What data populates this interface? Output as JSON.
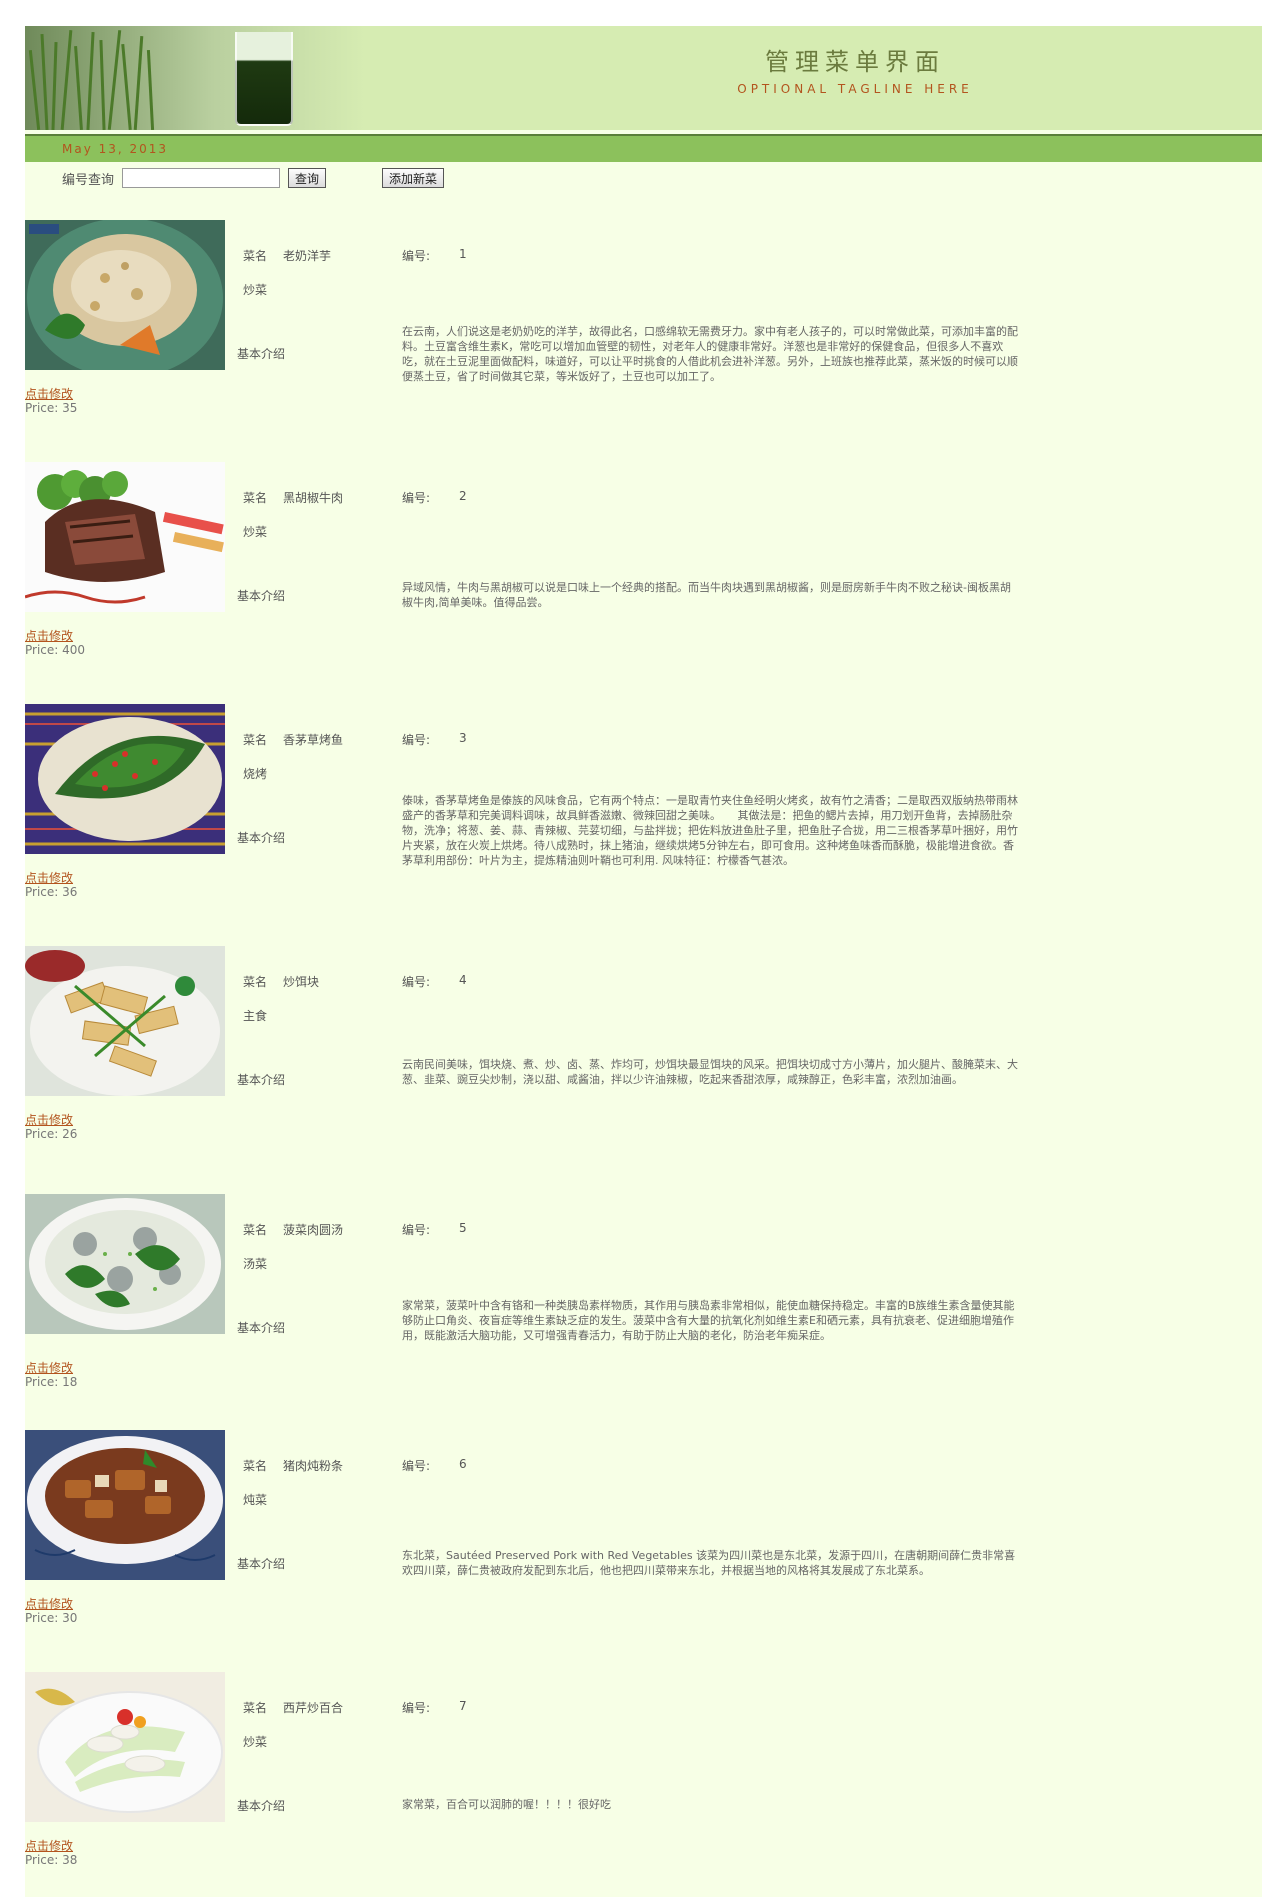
{
  "header": {
    "title": "管理菜单界面",
    "tagline": "OPTIONAL TAGLINE HERE",
    "date": "May 13, 2013"
  },
  "search": {
    "label": "编号查询",
    "value": "",
    "query_button": "查询",
    "add_button": "添加新菜"
  },
  "labels": {
    "name": "菜名",
    "id": "编号:",
    "intro": "基本介绍",
    "edit": "点击修改"
  },
  "dishes": [
    {
      "name": "老奶洋芋",
      "id": "1",
      "category": "炒菜",
      "price": "Price: 35",
      "description": "在云南，人们说这是老奶奶吃的洋芋，故得此名，口感绵软无需费牙力。家中有老人孩子的，可以时常做此菜，可添加丰富的配料。土豆富含维生素K，常吃可以增加血管壁的韧性，对老年人的健康非常好。洋葱也是非常好的保健食品，但很多人不喜欢吃，就在土豆泥里面做配料，味道好，可以让平时挑食的人借此机会进补洋葱。另外，上班族也推荐此菜，蒸米饭的时候可以顺便蒸土豆，省了时间做其它菜，等米饭好了，土豆也可以加工了。"
    },
    {
      "name": "黑胡椒牛肉",
      "id": "2",
      "category": "炒菜",
      "price": "Price: 400",
      "description": "异域风情，牛肉与黑胡椒可以说是口味上一个经典的搭配。而当牛肉块遇到黑胡椒酱，则是厨房新手牛肉不败之秘诀-闽板黑胡椒牛肉,简单美味。值得品尝。"
    },
    {
      "name": "香茅草烤鱼",
      "id": "3",
      "category": "烧烤",
      "price": "Price: 36",
      "description": "傣味，香茅草烤鱼是傣族的风味食品，它有两个特点：一是取青竹夹住鱼经明火烤炙，故有竹之清香；二是取西双版纳热带雨林盛产的香茅草和完美调料调味，故具鲜香滋嫩、微辣回甜之美味。　　其做法是：把鱼的鳃片去掉，用刀划开鱼背，去掉肠肚杂物，洗净；将葱、姜、蒜、青辣椒、芫荽切细，与盐拌拢；把佐料放进鱼肚子里，把鱼肚子合拢，用二三根香茅草叶捆好，用竹片夹紧，放在火炭上烘烤。待八成熟时，抹上猪油，继续烘烤5分钟左右，即可食用。这种烤鱼味香而酥脆，极能增进食欲。香茅草利用部份：叶片为主，提炼精油则叶鞘也可利用. 风味特征：柠檬香气甚浓。"
    },
    {
      "name": "炒饵块",
      "id": "4",
      "category": "主食",
      "price": "Price: 26",
      "description": "云南民间美味，饵块烧、煮、炒、卤、蒸、炸均可，炒饵块最显饵块的风采。把饵块切成寸方小薄片，加火腿片、酸腌菜末、大葱、韭菜、豌豆尖炒制，浇以甜、咸酱油，拌以少许油辣椒，吃起来香甜浓厚，咸辣醇正，色彩丰富，浓烈加油画。"
    },
    {
      "name": "菠菜肉圆汤",
      "id": "5",
      "category": "汤菜",
      "price": "Price: 18",
      "description": "家常菜，菠菜叶中含有铬和一种类胰岛素样物质，其作用与胰岛素非常相似，能使血糖保持稳定。丰富的B族维生素含量使其能够防止口角炎、夜盲症等维生素缺乏症的发生。菠菜中含有大量的抗氧化剂如维生素E和硒元素，具有抗衰老、促进细胞增殖作用，既能激活大脑功能，又可增强青春活力，有助于防止大脑的老化，防治老年痴呆症。"
    },
    {
      "name": "猪肉炖粉条",
      "id": "6",
      "category": "炖菜",
      "price": "Price: 30",
      "description": "东北菜，Sautéed Preserved Pork with Red Vegetables 该菜为四川菜也是东北菜，发源于四川，在唐朝期间薛仁贵非常喜欢四川菜，薛仁贵被政府发配到东北后，他也把四川菜带来东北，并根据当地的风格将其发展成了东北菜系。"
    },
    {
      "name": "西芹炒百合",
      "id": "7",
      "category": "炒菜",
      "price": "Price: 38",
      "description": "家常菜，百合可以润肺的喔！！！！很好吃"
    }
  ]
}
